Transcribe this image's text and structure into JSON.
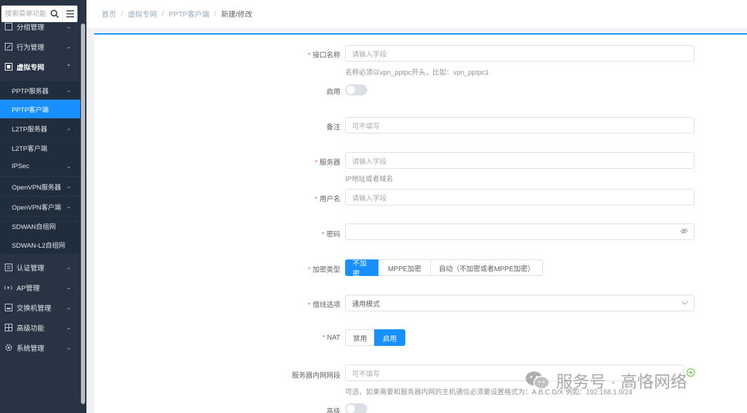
{
  "sidebar": {
    "search_placeholder": "搜索菜单功能",
    "items": [
      {
        "label": "分组管理",
        "icon": "group-icon"
      },
      {
        "label": "行为管理",
        "icon": "behavior-icon"
      },
      {
        "label": "虚拟专网",
        "icon": "vpn-icon"
      },
      {
        "label": "认证管理",
        "icon": "auth-icon"
      },
      {
        "label": "AP管理",
        "icon": "ap-icon"
      },
      {
        "label": "交换机管理",
        "icon": "switch-icon"
      },
      {
        "label": "高级功能",
        "icon": "advanced-icon"
      },
      {
        "label": "系统管理",
        "icon": "system-icon"
      }
    ],
    "sub_items": [
      {
        "label": "PPTP服务器"
      },
      {
        "label": "PPTP客户端"
      },
      {
        "label": "L2TP服务器"
      },
      {
        "label": "L2TP客户端"
      },
      {
        "label": "IPSec"
      },
      {
        "label": "OpenVPN服务器"
      },
      {
        "label": "OpenVPN客户端"
      },
      {
        "label": "SDWAN自组网"
      },
      {
        "label": "SDWAN-L2自组网"
      }
    ]
  },
  "breadcrumb": [
    "首页",
    "虚拟专网",
    "PPTP客户端",
    "新建/修改"
  ],
  "form": {
    "interface_name": {
      "label": "接口名称",
      "placeholder": "请输入字段",
      "hint": "名称必须以vpn_pptpc开头，比如：vpn_pptpc1"
    },
    "enable": {
      "label": "启用"
    },
    "remark": {
      "label": "备注",
      "placeholder": "可不填写"
    },
    "server": {
      "label": "服务器",
      "placeholder": "请输入字段",
      "hint": "IP地址或者域名"
    },
    "username": {
      "label": "用户名",
      "placeholder": "请输入字段"
    },
    "password": {
      "label": "密码",
      "placeholder": ""
    },
    "encryption": {
      "label": "加密类型",
      "options": [
        "不加密",
        "MPPE加密",
        "自动（不加密或者MPPE加密）"
      ],
      "selected": "不加密"
    },
    "line": {
      "label": "借线选项",
      "value": "通用模式"
    },
    "nat": {
      "label": "NAT",
      "options": [
        "禁用",
        "启用"
      ],
      "selected": "启用"
    },
    "lan_segment": {
      "label": "服务器内网网段",
      "placeholder": "可不填写",
      "hint": "可选，如果需要和服务器内网的主机通信必须要设置格式为：A.B.C.D/X 例如：192.168.1.0/24"
    },
    "advanced": {
      "label": "高级"
    }
  },
  "watermark": "服务号 · 高恪网络",
  "colors": {
    "accent": "#1890ff",
    "sidebar": "#283443",
    "required": "#f56c6c"
  }
}
